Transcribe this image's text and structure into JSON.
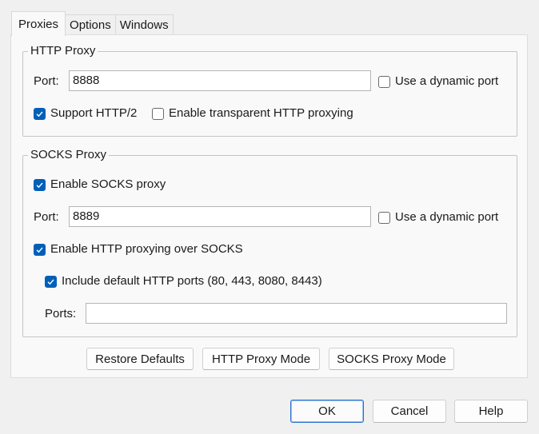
{
  "tabs": [
    {
      "label": "Proxies",
      "active": true
    },
    {
      "label": "Options",
      "active": false
    },
    {
      "label": "Windows",
      "active": false
    }
  ],
  "http_proxy": {
    "title": "HTTP Proxy",
    "port_label": "Port:",
    "port_value": "8888",
    "dynamic_port_label": "Use a dynamic port",
    "dynamic_port_checked": false,
    "http2_label": "Support HTTP/2",
    "http2_checked": true,
    "transparent_label": "Enable transparent HTTP proxying",
    "transparent_checked": false
  },
  "socks_proxy": {
    "title": "SOCKS Proxy",
    "enable_label": "Enable SOCKS proxy",
    "enable_checked": true,
    "port_label": "Port:",
    "port_value": "8889",
    "dynamic_port_label": "Use a dynamic port",
    "dynamic_port_checked": false,
    "http_over_socks_label": "Enable HTTP proxying over SOCKS",
    "http_over_socks_checked": true,
    "include_default_ports_label": "Include default HTTP ports (80, 443, 8080, 8443)",
    "include_default_ports_checked": true,
    "ports_label": "Ports:",
    "ports_value": ""
  },
  "panel_buttons": {
    "restore_defaults": "Restore Defaults",
    "http_proxy_mode": "HTTP Proxy Mode",
    "socks_proxy_mode": "SOCKS Proxy Mode"
  },
  "dialog_buttons": {
    "ok": "OK",
    "cancel": "Cancel",
    "help": "Help"
  },
  "colors": {
    "checkbox_checked": "#005fb8",
    "default_button_border": "#2a6fd0"
  }
}
